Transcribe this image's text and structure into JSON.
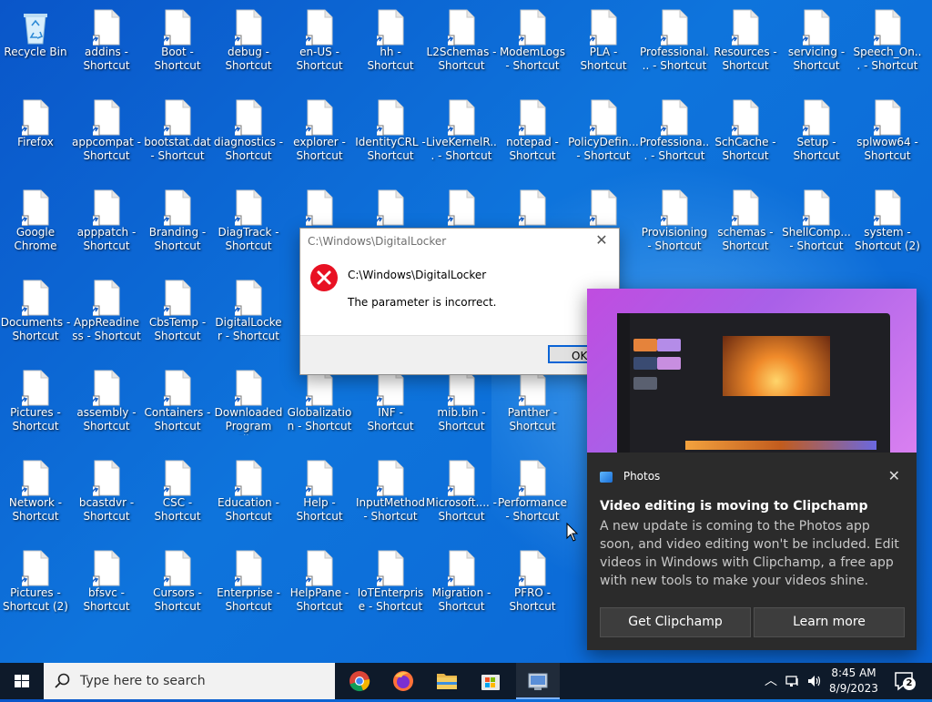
{
  "desktop": {
    "icons": [
      {
        "label": "Recycle Bin",
        "kind": "recycle"
      },
      {
        "label": "addins - Shortcut"
      },
      {
        "label": "Boot - Shortcut"
      },
      {
        "label": "debug - Shortcut"
      },
      {
        "label": "en-US - Shortcut"
      },
      {
        "label": "hh - Shortcut"
      },
      {
        "label": "L2Schemas - Shortcut"
      },
      {
        "label": "ModemLogs - Shortcut"
      },
      {
        "label": "PLA - Shortcut"
      },
      {
        "label": "Professional... - Shortcut"
      },
      {
        "label": "Resources - Shortcut"
      },
      {
        "label": "servicing - Shortcut"
      },
      {
        "label": "Speech_On... - Shortcut"
      },
      {
        "label": "Firefox"
      },
      {
        "label": "appcompat - Shortcut"
      },
      {
        "label": "bootstat.dat - Shortcut"
      },
      {
        "label": "diagnostics - Shortcut"
      },
      {
        "label": "explorer - Shortcut"
      },
      {
        "label": "IdentityCRL - Shortcut"
      },
      {
        "label": "LiveKernelR... - Shortcut"
      },
      {
        "label": "notepad - Shortcut"
      },
      {
        "label": "PolicyDefin... - Shortcut"
      },
      {
        "label": "Professiona... - Shortcut"
      },
      {
        "label": "SchCache - Shortcut"
      },
      {
        "label": "Setup - Shortcut"
      },
      {
        "label": "splwow64 - Shortcut"
      },
      {
        "label": "Google Chrome"
      },
      {
        "label": "apppatch - Shortcut"
      },
      {
        "label": "Branding - Shortcut"
      },
      {
        "label": "DiagTrack - Shortcut"
      },
      {
        "label": ""
      },
      {
        "label": ""
      },
      {
        "label": ""
      },
      {
        "label": ""
      },
      {
        "label": ""
      },
      {
        "label": "Provisioning - Shortcut"
      },
      {
        "label": "schemas - Shortcut"
      },
      {
        "label": "ShellComp... - Shortcut"
      },
      {
        "label": "system - Shortcut (2)"
      },
      {
        "label": "Documents - Shortcut"
      },
      {
        "label": "AppReadiness - Shortcut"
      },
      {
        "label": "CbsTemp - Shortcut"
      },
      {
        "label": "DigitalLocker - Shortcut"
      },
      {
        "label": "Pictures - Shortcut"
      },
      {
        "label": "assembly - Shortcut"
      },
      {
        "label": "Containers - Shortcut"
      },
      {
        "label": "Downloaded Program Fil..."
      },
      {
        "label": "Globalization - Shortcut"
      },
      {
        "label": "INF - Shortcut"
      },
      {
        "label": "mib.bin - Shortcut"
      },
      {
        "label": "Panther - Shortcut"
      },
      {
        "label": "Network - Shortcut"
      },
      {
        "label": "bcastdvr - Shortcut"
      },
      {
        "label": "CSC - Shortcut"
      },
      {
        "label": "Education - Shortcut"
      },
      {
        "label": "Help - Shortcut"
      },
      {
        "label": "InputMethod - Shortcut"
      },
      {
        "label": "Microsoft.... - Shortcut"
      },
      {
        "label": "Performance - Shortcut"
      },
      {
        "label": "Pictures - Shortcut (2)"
      },
      {
        "label": "bfsvc - Shortcut"
      },
      {
        "label": "Cursors - Shortcut"
      },
      {
        "label": "Enterprise - Shortcut"
      },
      {
        "label": "HelpPane - Shortcut"
      },
      {
        "label": "IoTEnterprise - Shortcut"
      },
      {
        "label": "Migration - Shortcut"
      },
      {
        "label": "PFRO - Shortcut"
      }
    ]
  },
  "dialog": {
    "title": "C:\\Windows\\DigitalLocker",
    "path": "C:\\Windows\\DigitalLocker",
    "message": "The parameter is incorrect.",
    "ok_label": "OK"
  },
  "toast": {
    "app_name": "Photos",
    "title": "Video editing is moving to Clipchamp",
    "body": "A new update is coming to the Photos app soon, and video editing won't be included. Edit videos in Windows with Clipchamp, a free app with new tools to make your videos shine.",
    "primary_label": "Get Clipchamp",
    "secondary_label": "Learn more"
  },
  "taskbar": {
    "search_placeholder": "Type here to search",
    "time": "8:45 AM",
    "date": "8/9/2023",
    "notification_count": "2"
  },
  "colors": {
    "accent": "#0a64d6",
    "error_red": "#e81123",
    "taskbar": "#0e1a2a"
  }
}
